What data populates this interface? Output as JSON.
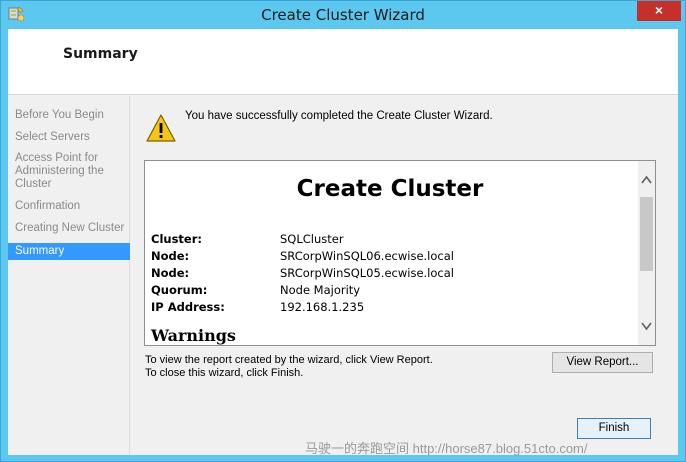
{
  "window": {
    "title": "Create Cluster Wizard",
    "close_glyph": "×"
  },
  "header": {
    "title": "Summary"
  },
  "nav": {
    "items": [
      "Before You Begin",
      "Select Servers",
      "Access Point for Administering the Cluster",
      "Confirmation",
      "Creating New Cluster",
      "Summary"
    ],
    "active_index": 5
  },
  "content": {
    "success_message": "You have successfully completed the Create Cluster Wizard.",
    "report": {
      "title": "Create Cluster",
      "rows": [
        {
          "key": "Cluster:",
          "value": "SQLCluster"
        },
        {
          "key": "Node:",
          "value": "SRCorpWinSQL06.ecwise.local"
        },
        {
          "key": "Node:",
          "value": "SRCorpWinSQL05.ecwise.local"
        },
        {
          "key": "Quorum:",
          "value": "Node Majority"
        },
        {
          "key": "IP Address:",
          "value": "192.168.1.235"
        }
      ],
      "warnings_heading": "Warnings"
    },
    "hint_view_report": "To view the report created by the wizard, click View Report.",
    "hint_close": "To close this wizard, click Finish.",
    "view_report_label": "View Report...",
    "finish_label": "Finish"
  },
  "watermark": "马驶一的奔跑空间 http://horse87.blog.51cto.com/",
  "colors": {
    "titlebar": "#5cc8ef",
    "active_nav": "#3399ff",
    "close_button": "#c7302a"
  },
  "icons": {
    "app": "cluster-wizard-icon",
    "warning": "warning-icon",
    "scroll_up": "chevron-up-icon",
    "scroll_down": "chevron-down-icon"
  }
}
